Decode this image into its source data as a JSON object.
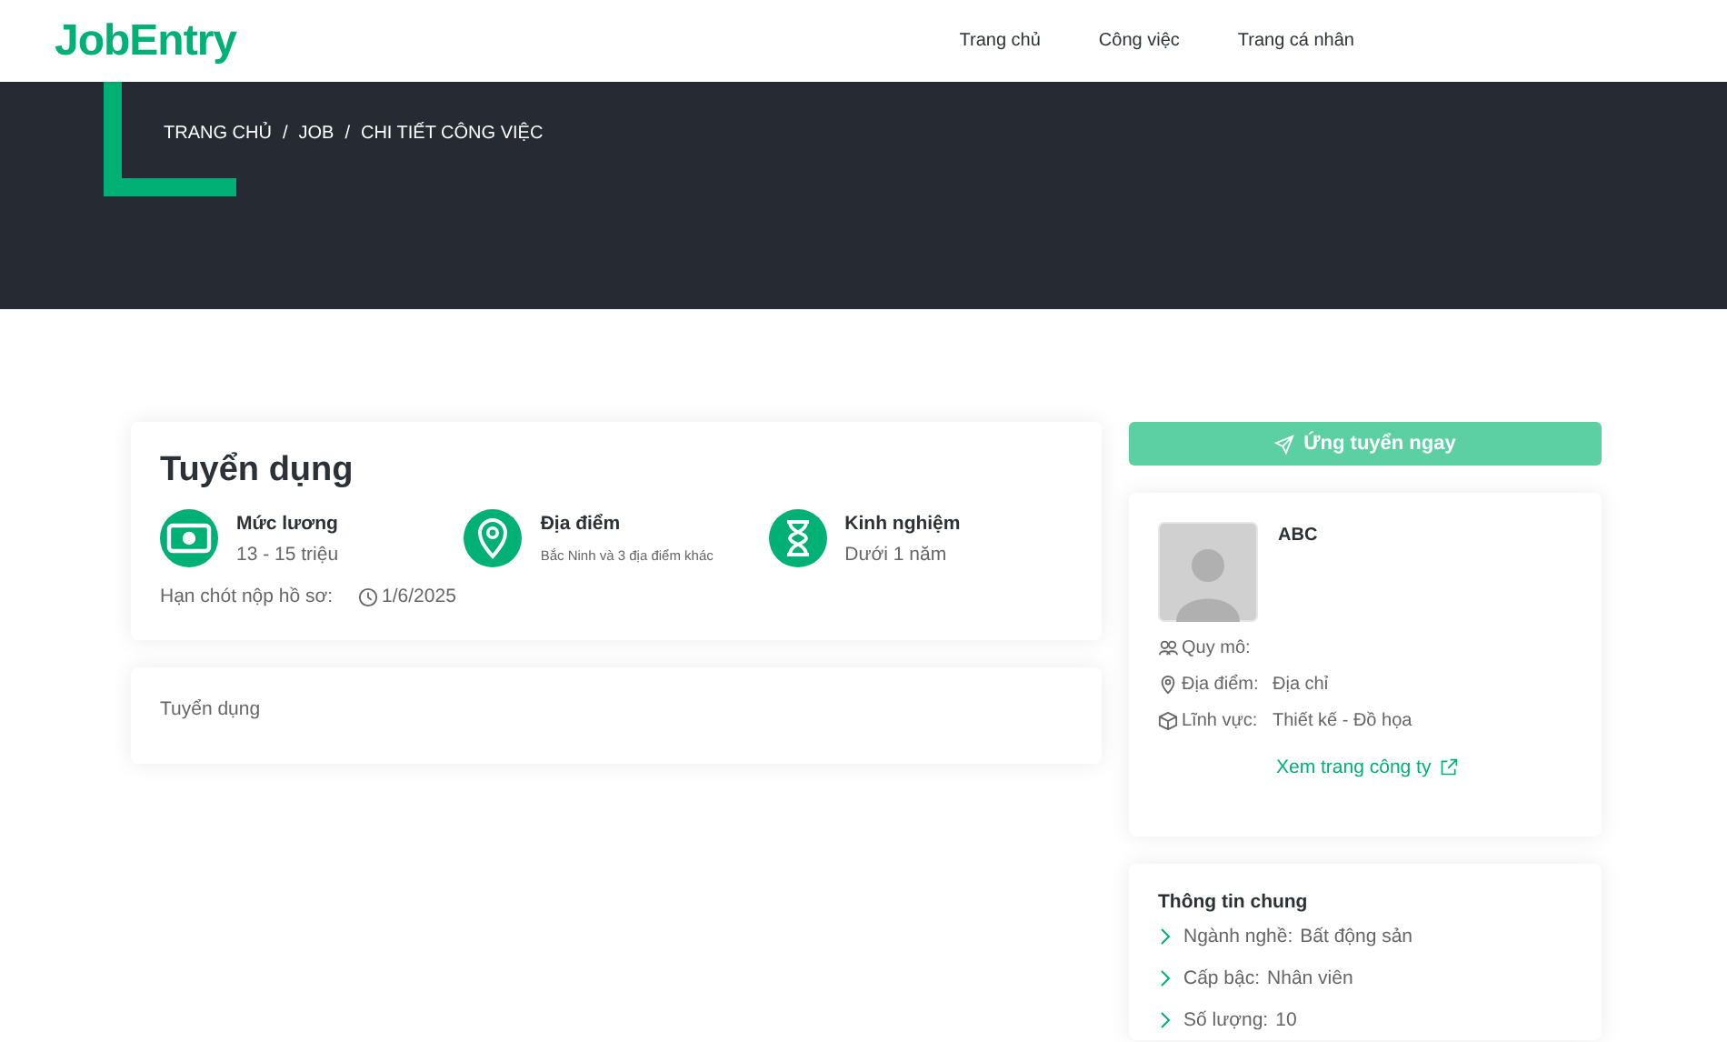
{
  "navbar": {
    "logo": "JobEntry",
    "links": [
      {
        "label": "Trang chủ"
      },
      {
        "label": "Công việc"
      },
      {
        "label": "Trang cá nhân"
      }
    ]
  },
  "hero": {
    "breadcrumb": [
      {
        "label": "TRANG CHỦ",
        "separator": "/"
      },
      {
        "label": "JOB",
        "separator": "/"
      },
      {
        "label": "CHI TIẾT CÔNG VIỆC"
      }
    ]
  },
  "job": {
    "title": "Tuyển dụng",
    "facts": [
      {
        "kind": "salary",
        "label": "Mức lương",
        "value": "13 - 15 triệu"
      },
      {
        "kind": "location",
        "label": "Địa điểm",
        "value": "Bắc Ninh và 3 địa điểm khác"
      },
      {
        "kind": "experience",
        "label": "Kinh nghiệm",
        "value": "Dưới 1 năm"
      }
    ],
    "deadline_label": "Hạn chót nộp hồ sơ:",
    "deadline": "1/6/2025",
    "description": "Tuyển dụng"
  },
  "apply_button": "Ứng tuyển ngay",
  "company": {
    "name": "ABC",
    "rows": [
      {
        "kind": "size",
        "label": "Quy mô:"
      },
      {
        "kind": "location",
        "label": "Địa điểm:",
        "value": "Địa chỉ"
      },
      {
        "kind": "field",
        "label": "Lĩnh vực:",
        "value": "Thiết kế - Đồ họa"
      }
    ],
    "link": "Xem trang công ty"
  },
  "general": {
    "title": "Thông tin chung",
    "rows": [
      {
        "label": "Ngành nghề:",
        "value": "Bất động sản"
      },
      {
        "label": "Cấp bậc:",
        "value": "Nhân viên"
      },
      {
        "label": "Số lượng:",
        "value": "10"
      }
    ]
  }
}
